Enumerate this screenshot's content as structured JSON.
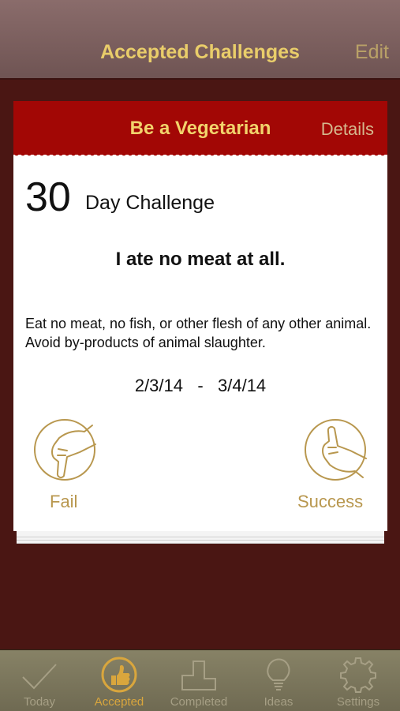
{
  "nav": {
    "title": "Accepted Challenges",
    "edit_label": "Edit"
  },
  "card": {
    "title": "Be a Vegetarian",
    "details_label": "Details",
    "days": "30",
    "days_label": "Day Challenge",
    "motto": "I ate no meat at all.",
    "description": "Eat no meat, no fish, or other flesh of any other animal. Avoid by-products of animal slaughter.",
    "dates": "2/3/14   -   3/4/14",
    "fail_label": "Fail",
    "success_label": "Success"
  },
  "tabs": [
    {
      "label": "Today",
      "icon": "checkmark-icon",
      "active": false
    },
    {
      "label": "Accepted",
      "icon": "thumbs-up-icon",
      "active": true
    },
    {
      "label": "Completed",
      "icon": "podium-icon",
      "active": false
    },
    {
      "label": "Ideas",
      "icon": "lightbulb-icon",
      "active": false
    },
    {
      "label": "Settings",
      "icon": "gear-icon",
      "active": false
    }
  ],
  "colors": {
    "background": "#4a1613",
    "header_red": "#a20705",
    "gold": "#e9cd6a",
    "button_gold": "#b8974e",
    "tab_active": "#d9a63d"
  }
}
